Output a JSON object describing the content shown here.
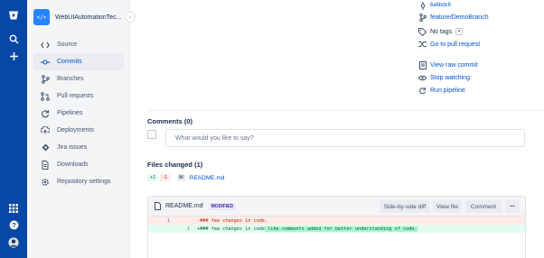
{
  "global_nav": {
    "icons": [
      "bitbucket-logo-icon",
      "search-icon",
      "create-plus-icon",
      "app-switcher-icon",
      "help-icon",
      "user-avatar"
    ]
  },
  "repo": {
    "avatar_glyph": "</>",
    "name": "WebUIAutomationTec..."
  },
  "sidebar": {
    "items": [
      {
        "label": "Source",
        "icon": "source-code-icon"
      },
      {
        "label": "Commits",
        "icon": "commits-icon",
        "active": true
      },
      {
        "label": "Branches",
        "icon": "branches-icon"
      },
      {
        "label": "Pull requests",
        "icon": "pull-requests-icon"
      },
      {
        "label": "Pipelines",
        "icon": "pipelines-icon"
      },
      {
        "label": "Deployments",
        "icon": "deployments-icon"
      },
      {
        "label": "Jira issues",
        "icon": "jira-icon"
      },
      {
        "label": "Downloads",
        "icon": "downloads-icon"
      },
      {
        "label": "Repository settings",
        "icon": "settings-gear-icon"
      }
    ]
  },
  "commit_meta": {
    "hash": "6a6bdc6",
    "branch": "feature/DemoBranch",
    "tags": "No tags",
    "pull_request": "Go to pull request",
    "raw_commit": "View raw commit",
    "stop_watching": "Stop watching",
    "run_pipeline": "Run pipeline"
  },
  "comments": {
    "title": "Comments (0)",
    "placeholder": "What would you like to say?"
  },
  "files_changed": {
    "title": "Files changed (1)",
    "additions": "+1",
    "deletions": "-1",
    "status_letter": "M",
    "file_name": "README.md"
  },
  "diff": {
    "file_name": "README.md",
    "status": "MODIFIED",
    "buttons": {
      "side_by_side": "Side-by-side diff",
      "view_file": "View file",
      "comment": "Comment",
      "more": "•••"
    },
    "lines": [
      {
        "type": "del",
        "old": "1",
        "new": "",
        "prefix": "-",
        "code": "### few changes in code.",
        "highlight": ""
      },
      {
        "type": "add",
        "old": "",
        "new": "1",
        "prefix": "+",
        "code": "### few changes in code",
        "highlight": " like comments added for better understanding of code."
      }
    ]
  },
  "colors": {
    "global_nav": "#0747a6",
    "link": "#0052cc",
    "addition_bg": "#e3fcef",
    "deletion_bg": "#ffebe9"
  }
}
